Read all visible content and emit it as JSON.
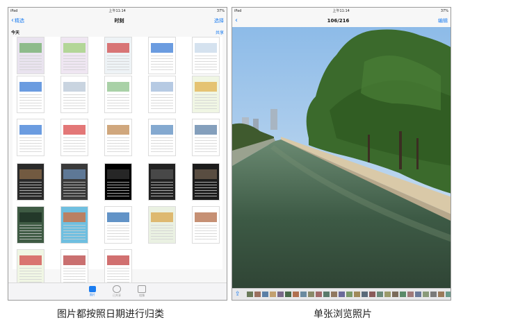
{
  "left": {
    "status": {
      "device": "iPad",
      "time": "上午11:14",
      "battery": "37%"
    },
    "nav": {
      "back": "精选",
      "title": "时刻",
      "action": "选择"
    },
    "section": {
      "date": "今天",
      "share": "共享"
    },
    "tabs": [
      {
        "label": "照片",
        "active": true
      },
      {
        "label": "已共享",
        "active": false
      },
      {
        "label": "相簿",
        "active": false
      }
    ],
    "caption": "图片都按照日期进行归类"
  },
  "right": {
    "status": {
      "device": "iPad",
      "time": "上午11:14",
      "battery": "37%"
    },
    "nav": {
      "back": "",
      "title": "106/216",
      "action": "编辑"
    },
    "caption": "单张浏览照片"
  },
  "thumbnails": [
    {
      "bg": "#e9e3ef",
      "accent": "#6fae6a"
    },
    {
      "bg": "#efe6f2",
      "accent": "#9fd07a"
    },
    {
      "bg": "#eef3f6",
      "accent": "#d04b4b"
    },
    {
      "bg": "#ffffff",
      "accent": "#3a7bd5"
    },
    {
      "bg": "#ffffff",
      "accent": "#c7d8ea"
    },
    {
      "bg": "#ffffff",
      "accent": "#3a7bd5"
    },
    {
      "bg": "#ffffff",
      "accent": "#b7c5d6"
    },
    {
      "bg": "#ffffff",
      "accent": "#8cc18a"
    },
    {
      "bg": "#ffffff",
      "accent": "#9db8d9"
    },
    {
      "bg": "#f0f6e4",
      "accent": "#e2b24e"
    },
    {
      "bg": "#ffffff",
      "accent": "#3a7bd5"
    },
    {
      "bg": "#ffffff",
      "accent": "#d94a4a"
    },
    {
      "bg": "#ffffff",
      "accent": "#c08a52"
    },
    {
      "bg": "#ffffff",
      "accent": "#5b8cc0"
    },
    {
      "bg": "#ffffff",
      "accent": "#5b7fa6"
    },
    {
      "bg": "#2a2a2a",
      "accent": "#8b6b4a"
    },
    {
      "bg": "#3a3a3a",
      "accent": "#6b8db5"
    },
    {
      "bg": "#000000",
      "accent": "#333"
    },
    {
      "bg": "#222222",
      "accent": "#555"
    },
    {
      "bg": "#1c1c1c",
      "accent": "#6e5e4e"
    },
    {
      "bg": "#3f5b44",
      "accent": "#1b2d21"
    },
    {
      "bg": "#6fbfe0",
      "accent": "#d36b3a"
    },
    {
      "bg": "#ffffff",
      "accent": "#2e6fb4"
    },
    {
      "bg": "#eaf1e2",
      "accent": "#d9a54a"
    },
    {
      "bg": "#ffffff",
      "accent": "#b36b45"
    },
    {
      "bg": "#f0f6e4",
      "accent": "#d24a4a"
    },
    {
      "bg": "#ffffff",
      "accent": "#b84040"
    },
    {
      "bg": "#ffffff",
      "accent": "#c24040"
    }
  ]
}
